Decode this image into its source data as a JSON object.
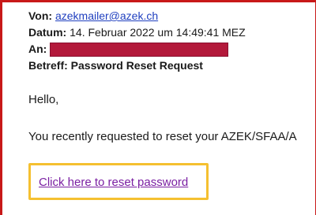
{
  "email": {
    "from_label": "Von:",
    "from_value": "azekmailer@azek.ch",
    "date_label": "Datum:",
    "date_value": "14. Februar 2022 um 14:49:41 MEZ",
    "to_label": "An:",
    "subject_label": "Betreff:",
    "subject_value": "Password Reset Request",
    "greeting": "Hello,",
    "body_text": "You recently requested to reset your AZEK/SFAA/A",
    "reset_link": "Click here to reset password"
  },
  "colors": {
    "frame_border": "#c81919",
    "redaction": "#b3193b",
    "highlight": "#f5c030",
    "link_visited": "#7a1fa2",
    "link": "#1f3fbf"
  }
}
